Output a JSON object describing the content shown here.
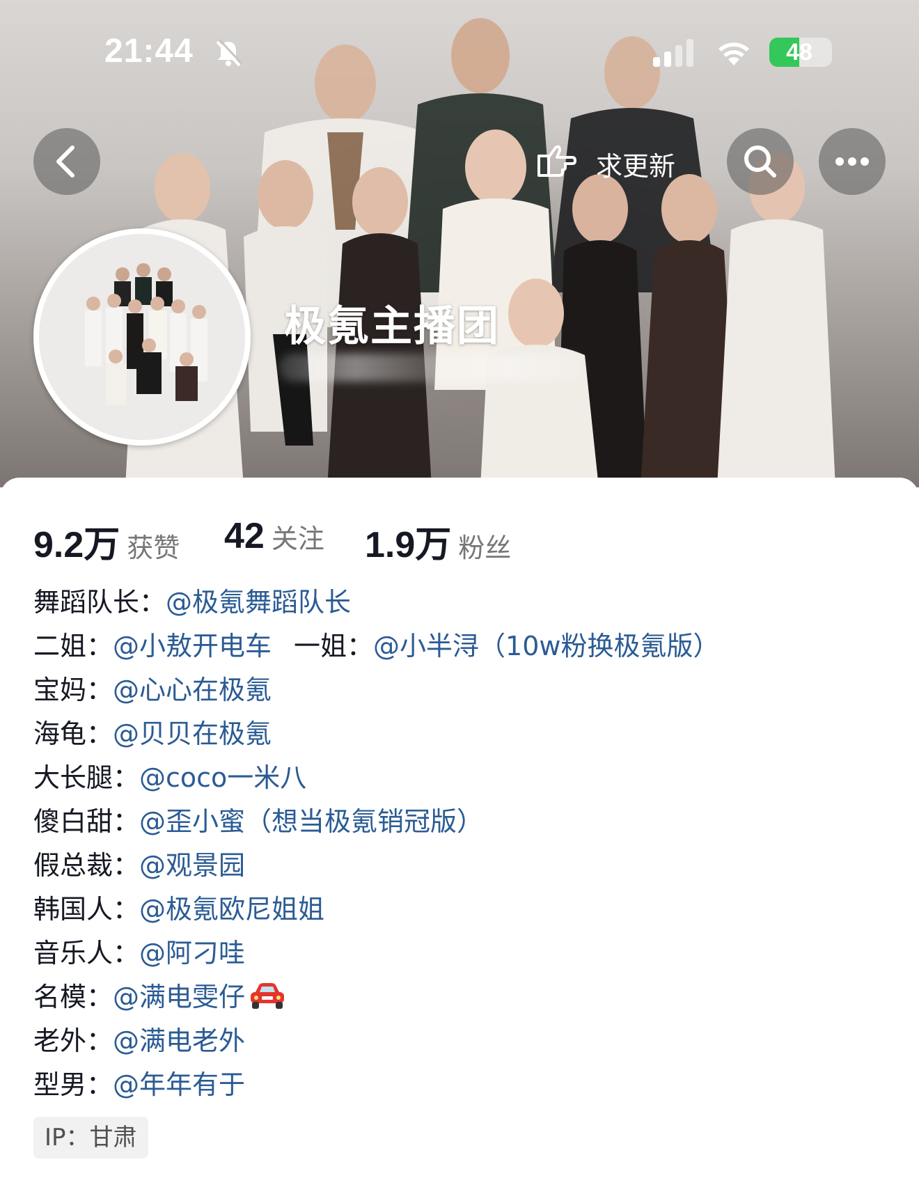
{
  "status_bar": {
    "time": "21:44",
    "battery": "48",
    "battery_level": 0.48,
    "icons": [
      "bell-slash-icon",
      "cellular-signal-icon",
      "wifi-icon",
      "battery-charging-icon"
    ]
  },
  "header": {
    "request_update_label": "求更新",
    "icons": [
      "back-arrow-icon",
      "pointing-hand-icon",
      "search-icon",
      "more-icon"
    ]
  },
  "profile": {
    "nickname": "极氪主播团"
  },
  "stats": [
    {
      "value": "9.2万",
      "label": "获赞"
    },
    {
      "value": "42",
      "label": "关注"
    },
    {
      "value": "1.9万",
      "label": "粉丝"
    }
  ],
  "bio": {
    "lines": [
      {
        "label": "舞蹈队长：",
        "mention": "@极氪舞蹈队长"
      },
      {
        "label": "二姐：",
        "mention": "@小敖开电车",
        "label2": "一姐：",
        "mention2": "@小半浔（10w粉换极氪版）"
      },
      {
        "label": "宝妈：",
        "mention": "@心心在极氪"
      },
      {
        "label": "海龟：",
        "mention": "@贝贝在极氪"
      },
      {
        "label": "大长腿：",
        "mention": "@coco一米八"
      },
      {
        "label": "傻白甜：",
        "mention": "@歪小蜜（想当极氪销冠版）"
      },
      {
        "label": "假总裁：",
        "mention": "@观景园"
      },
      {
        "label": "韩国人：",
        "mention": "@极氪欧尼姐姐"
      },
      {
        "label": "音乐人：",
        "mention": "@阿刁哇"
      },
      {
        "label": "名模：",
        "mention": "@满电雯仔",
        "emoji": "car-icon"
      },
      {
        "label": "老外：",
        "mention": "@满电老外"
      },
      {
        "label": "型男：",
        "mention": "@年年有于"
      }
    ]
  },
  "ip": {
    "label": "IP：甘肃"
  },
  "colors": {
    "mention": "#2b5b94",
    "text": "#161823",
    "secondary": "#767676",
    "battery_green": "#34c759"
  }
}
